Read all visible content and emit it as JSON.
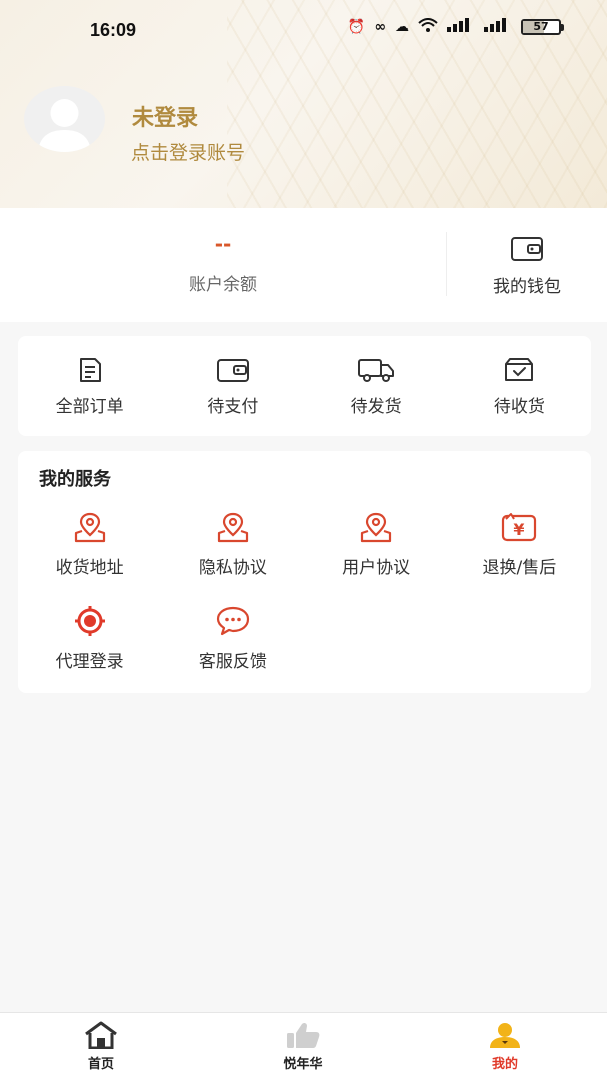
{
  "status_bar": {
    "time": "16:09",
    "icons": [
      "alarm-icon",
      "sync-icon",
      "hd-cloud-icon",
      "wifi-icon",
      "signal-icon",
      "signal-icon"
    ],
    "battery_level": "57"
  },
  "profile": {
    "title": "未登录",
    "subtitle": "点击登录账号"
  },
  "balance": {
    "value": "--",
    "label": "账户余额",
    "wallet_label": "我的钱包"
  },
  "orders": {
    "items": [
      {
        "label": "全部订单",
        "icon": "document-icon"
      },
      {
        "label": "待支付",
        "icon": "wallet-icon"
      },
      {
        "label": "待发货",
        "icon": "truck-icon"
      },
      {
        "label": "待收货",
        "icon": "box-check-icon"
      }
    ]
  },
  "services": {
    "title": "我的服务",
    "items": [
      {
        "label": "收货地址",
        "icon": "map-pin-icon"
      },
      {
        "label": "隐私协议",
        "icon": "map-pin-icon"
      },
      {
        "label": "用户协议",
        "icon": "map-pin-icon"
      },
      {
        "label": "退换/售后",
        "icon": "refund-icon"
      },
      {
        "label": "代理登录",
        "icon": "target-icon"
      },
      {
        "label": "客服反馈",
        "icon": "chat-icon"
      }
    ]
  },
  "nav": {
    "items": [
      {
        "label": "首页",
        "icon": "home-icon"
      },
      {
        "label": "悦年华",
        "icon": "thumbs-up-icon"
      },
      {
        "label": "我的",
        "icon": "person-icon"
      }
    ],
    "active_index": 2
  },
  "colors": {
    "accent": "#e03a2a",
    "gold": "#b08a3e",
    "icon_red": "#d9472e",
    "balance_value": "#d9572a"
  }
}
